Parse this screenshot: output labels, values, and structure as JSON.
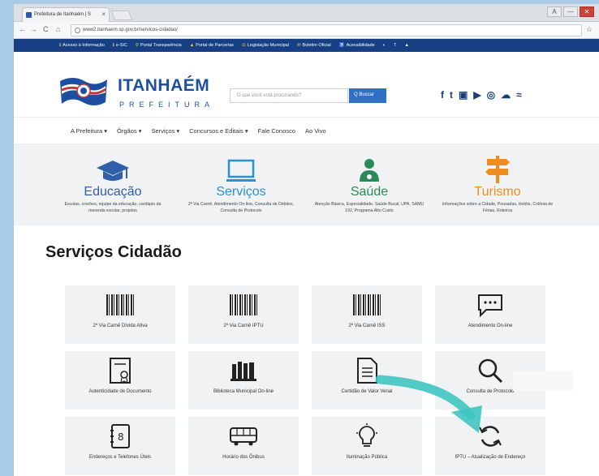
{
  "browser": {
    "tab_title": "Prefeitura de Itanhaém | S",
    "tab_close": "×",
    "url": "www2.itanhaem.sp.gov.br/servicos-cidadao/",
    "nav_back": "←",
    "nav_forward": "→",
    "nav_reload": "C",
    "nav_home": "⌂",
    "bookmark_star": "☆",
    "window_controls": [
      "A",
      "—",
      "✕"
    ]
  },
  "govbar": {
    "items": [
      {
        "icon": "ℹ",
        "label": "Acesso à Informação"
      },
      {
        "icon": "ℹ",
        "label": "e-SIC"
      },
      {
        "icon": "⚲",
        "label": "Portal Transparência"
      },
      {
        "icon": "▲",
        "label": "Portal de Parcerias"
      },
      {
        "icon": "⚖",
        "label": "Legislação Municipal"
      },
      {
        "icon": "✉",
        "label": "Boletim Oficial"
      },
      {
        "icon": "♿",
        "label": "Acessibilidade"
      }
    ]
  },
  "header": {
    "title": "ITANHAÉM",
    "subtitle": "PREFEITURA",
    "search_placeholder": "O que você está procurando?",
    "search_button": "Q Buscar",
    "social_icons": [
      "f",
      "t",
      "▣",
      "▶",
      "◎",
      "☁",
      "≈"
    ]
  },
  "menu": {
    "items": [
      "A Prefeitura ▾",
      "Órgãos ▾",
      "Serviços ▾",
      "Concursos e Editais ▾",
      "Fale Conosco",
      "Ao Vivo"
    ]
  },
  "categories": [
    {
      "name": "Educação",
      "desc": "Escolas, creches, equipe da educação, cardápio da merenda escolar, projetos",
      "color": "#2e5fa8"
    },
    {
      "name": "Serviços",
      "desc": "2ª Via Carnê, Atendimento On-line, Consulta de Débitos, Consulta de Protocolo",
      "color": "#2d8fd5"
    },
    {
      "name": "Saúde",
      "desc": "Atenção Básica, Especialidade, Saúde Bucal, UPA, SAMU 192, Programa Alto Custo",
      "color": "#2b8a5a"
    },
    {
      "name": "Turismo",
      "desc": "Informações sobre a Cidade, Pousadas, Hotéis, Colônia de Férias, Roteiros",
      "color": "#f08c1e"
    }
  ],
  "page_title": "Serviços Cidadão",
  "services": [
    {
      "label": "2ª Via Carnê Dívida Ativa",
      "icon": "barcode-icon"
    },
    {
      "label": "2ª Via Carnê IPTU",
      "icon": "barcode-icon"
    },
    {
      "label": "2ª Via Carnê ISS",
      "icon": "barcode-icon"
    },
    {
      "label": "Atendimento On-line",
      "icon": "chat-icon"
    },
    {
      "label": "Autenticidade de Documento",
      "icon": "certificate-icon"
    },
    {
      "label": "Biblioteca Municipal On-line",
      "icon": "books-icon"
    },
    {
      "label": "Certidão de Valor Venal",
      "icon": "document-icon"
    },
    {
      "label": "Consulta de Protocolo",
      "icon": "magnifier-icon"
    },
    {
      "label": "Endereços e Telefones Úteis",
      "icon": "address-book-icon"
    },
    {
      "label": "Horário dos Ônibus",
      "icon": "bus-icon"
    },
    {
      "label": "Iluminação Pública",
      "icon": "lightbulb-icon"
    },
    {
      "label": "IPTU – Atualização de Endereço",
      "icon": "refresh-icon"
    }
  ],
  "colors": {
    "accent": "#1d4fa0",
    "govbar": "#173f84",
    "arrow": "#3fc4c1"
  }
}
